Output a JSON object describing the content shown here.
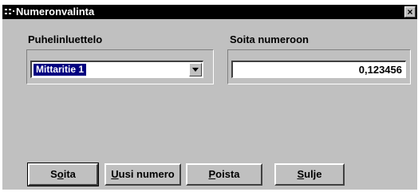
{
  "window": {
    "title": "Numeronvalinta",
    "close_glyph": "×"
  },
  "phonebook": {
    "label": "Puhelinluettelo",
    "selected": "Mittaritie 1"
  },
  "call_number": {
    "label": "Soita numeroon",
    "value": "0,123456"
  },
  "buttons": {
    "call": {
      "pre": "S",
      "mnemonic": "o",
      "post": "ita"
    },
    "new_number": {
      "pre": "",
      "mnemonic": "U",
      "post": "usi numero"
    },
    "remove": {
      "pre": "",
      "mnemonic": "P",
      "post": "oista"
    },
    "close": {
      "pre": "",
      "mnemonic": "S",
      "post": "ulje"
    }
  },
  "icons": {
    "title": "phone-dial-icon",
    "dropdown": "chevron-down-icon"
  }
}
